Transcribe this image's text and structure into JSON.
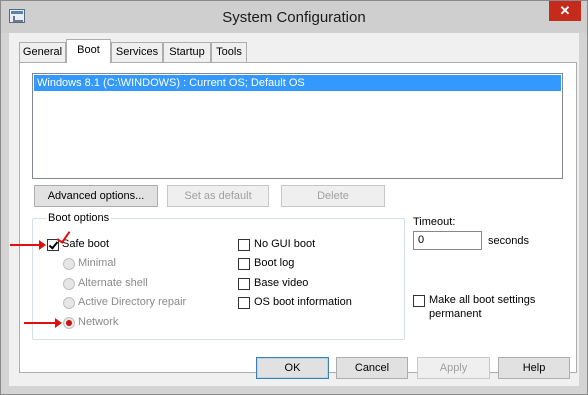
{
  "window": {
    "title": "System Configuration",
    "close_glyph": "✕"
  },
  "tabs": [
    {
      "label": "General",
      "active": false
    },
    {
      "label": "Boot",
      "active": true
    },
    {
      "label": "Services",
      "active": false
    },
    {
      "label": "Startup",
      "active": false
    },
    {
      "label": "Tools",
      "active": false
    }
  ],
  "os_list": {
    "selected_entry": "Windows 8.1 (C:\\WINDOWS) : Current OS; Default OS"
  },
  "boot_buttons": {
    "advanced": "Advanced options...",
    "set_default": "Set as default",
    "delete": "Delete"
  },
  "boot_options": {
    "group_label": "Boot options",
    "safe_boot": {
      "label": "Safe boot",
      "checked": true
    },
    "radios": [
      {
        "label": "Minimal",
        "selected": false
      },
      {
        "label": "Alternate shell",
        "selected": false
      },
      {
        "label": "Active Directory repair",
        "selected": false
      },
      {
        "label": "Network",
        "selected": true
      }
    ],
    "checkboxes": [
      {
        "label": "No GUI boot",
        "checked": false
      },
      {
        "label": "Boot log",
        "checked": false
      },
      {
        "label": "Base video",
        "checked": false
      },
      {
        "label": "OS boot information",
        "checked": false
      }
    ]
  },
  "timeout": {
    "label": "Timeout:",
    "value": "0",
    "unit": "seconds"
  },
  "permanent": {
    "line1": "Make all boot settings",
    "line2": "permanent",
    "checked": false
  },
  "dialog_buttons": {
    "ok": "OK",
    "cancel": "Cancel",
    "apply": "Apply",
    "help": "Help"
  },
  "colors": {
    "selection": "#3399ff",
    "annotation": "#e01010",
    "close": "#c42b1c"
  },
  "annotations": [
    "red-arrow-safe-boot",
    "red-arrow-network"
  ]
}
